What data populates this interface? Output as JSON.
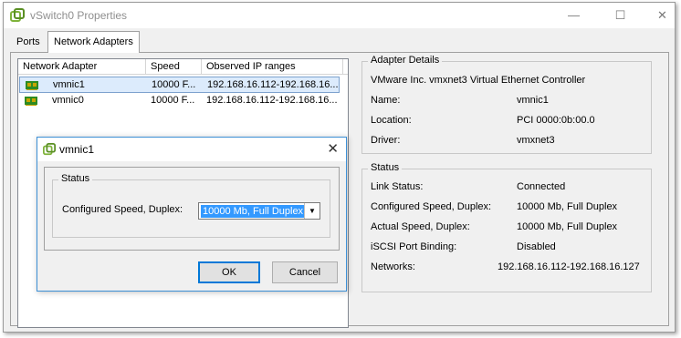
{
  "window": {
    "title": "vSwitch0 Properties",
    "minimize_glyph": "—",
    "maximize_glyph": "☐",
    "close_glyph": "✕"
  },
  "tabs": [
    {
      "label": "Ports",
      "active": false
    },
    {
      "label": "Network Adapters",
      "active": true
    }
  ],
  "adapter_list": {
    "columns": [
      "Network Adapter",
      "Speed",
      "Observed IP ranges"
    ],
    "rows": [
      {
        "name": "vmnic1",
        "speed": "10000 F...",
        "ip": "192.168.16.112-192.168.16...",
        "selected": true
      },
      {
        "name": "vmnic0",
        "speed": "10000 F...",
        "ip": "192.168.16.112-192.168.16...",
        "selected": false
      }
    ]
  },
  "adapter_details": {
    "title": "Adapter Details",
    "description": "VMware Inc. vmxnet3 Virtual Ethernet Controller",
    "name_label": "Name:",
    "name_value": "vmnic1",
    "location_label": "Location:",
    "location_value": "PCI 0000:0b:00.0",
    "driver_label": "Driver:",
    "driver_value": "vmxnet3"
  },
  "status": {
    "title": "Status",
    "link_label": "Link Status:",
    "link_value": "Connected",
    "configured_label": "Configured Speed, Duplex:",
    "configured_value": "10000 Mb, Full Duplex",
    "actual_label": "Actual Speed, Duplex:",
    "actual_value": "10000 Mb, Full Duplex",
    "iscsi_label": "iSCSI Port Binding:",
    "iscsi_value": "Disabled",
    "networks_label": "Networks:",
    "networks_value": "192.168.16.112-192.168.16.127"
  },
  "dialog": {
    "title": "vmnic1",
    "close_glyph": "✕",
    "group_title": "Status",
    "field_label": "Configured Speed, Duplex:",
    "field_value": "10000 Mb, Full Duplex",
    "dropdown_glyph": "▼",
    "ok_label": "OK",
    "cancel_label": "Cancel"
  },
  "colors": {
    "selection_bg": "#3399ff",
    "row_selected_bg": "#dcebfc",
    "dialog_border": "#3d90d6",
    "vmware_icon_green": "#7fb33b",
    "nic_icon_green": "#2e8b22"
  }
}
